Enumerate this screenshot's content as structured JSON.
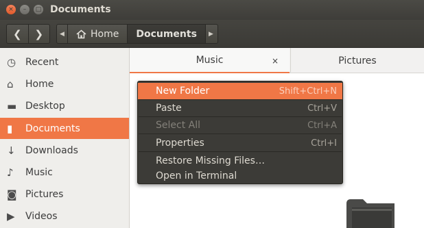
{
  "window": {
    "title": "Documents",
    "close_glyph": "×",
    "minimize_glyph": "–",
    "maximize_glyph": "□"
  },
  "toolbar": {
    "back_glyph": "❮",
    "forward_glyph": "❯",
    "path_left_arrow": "◀",
    "path_right_arrow": "▶",
    "breadcrumbs": [
      {
        "label": "Home",
        "icon": "home-icon"
      },
      {
        "label": "Documents"
      }
    ]
  },
  "sidebar": {
    "items": [
      {
        "label": "Recent",
        "icon": "clock-icon",
        "glyph": "◷"
      },
      {
        "label": "Home",
        "icon": "home-icon",
        "glyph": "⌂"
      },
      {
        "label": "Desktop",
        "icon": "folder-icon",
        "glyph": "▬"
      },
      {
        "label": "Documents",
        "icon": "document-icon",
        "glyph": "▮",
        "active": true
      },
      {
        "label": "Downloads",
        "icon": "download-icon",
        "glyph": "↓"
      },
      {
        "label": "Music",
        "icon": "music-icon",
        "glyph": "♪"
      },
      {
        "label": "Pictures",
        "icon": "camera-icon",
        "glyph": "◙"
      },
      {
        "label": "Videos",
        "icon": "video-icon",
        "glyph": "▶"
      }
    ]
  },
  "tabs": [
    {
      "label": "Music",
      "close": "×",
      "active": true
    },
    {
      "label": "Pictures"
    }
  ],
  "context_menu": {
    "items": [
      {
        "label": "New Folder",
        "accel": "Shift+Ctrl+N",
        "highlighted": true
      },
      {
        "label": "Paste",
        "accel": "Ctrl+V"
      },
      {
        "label": "Select All",
        "accel": "Ctrl+A",
        "disabled": true
      },
      {
        "label": "Properties",
        "accel": "Ctrl+I"
      },
      {
        "label": "Restore Missing Files…",
        "accel": ""
      },
      {
        "label": "Open in Terminal",
        "accel": ""
      }
    ]
  },
  "colors": {
    "accent": "#f07746",
    "titlebar": "#3e3d39",
    "menu_bg": "#3c3b37"
  }
}
